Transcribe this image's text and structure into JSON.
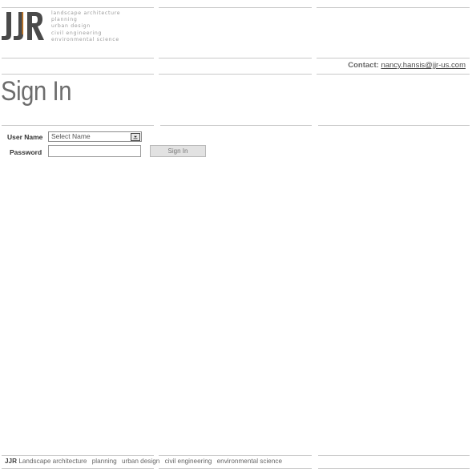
{
  "brand": {
    "logo_text": "JJR",
    "tagline_lines": [
      "landscape architecture",
      "planning",
      "urban design",
      "civil engineering",
      "environmental science"
    ],
    "logo_accent_color": "#c9771f",
    "logo_dark_color": "#4a4a4a"
  },
  "contact": {
    "label": "Contact:",
    "email": "nancy.hansis@jjr-us.com"
  },
  "page_title": "Sign In",
  "form": {
    "username_label": "User Name",
    "username_value": "Select Name",
    "password_label": "Password",
    "password_value": "",
    "submit_label": "Sign In"
  },
  "footer": {
    "brand": "JJR",
    "items": [
      "Landscape architecture",
      "planning",
      "urban design",
      "civil engineering",
      "environmental science"
    ]
  },
  "colors": {
    "rule": "#c9c9c9",
    "title": "#6d6d6d",
    "button_bg": "#e2e2e2"
  }
}
